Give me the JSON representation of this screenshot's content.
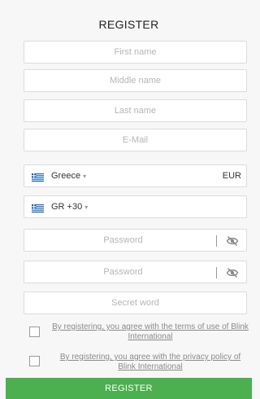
{
  "form": {
    "title": "REGISTER",
    "first_name_placeholder": "First name",
    "middle_name_placeholder": "Middle name",
    "last_name_placeholder": "Last name",
    "email_placeholder": "E-Mail",
    "country": {
      "flag_icon": "greece-flag-icon",
      "value": "Greece",
      "currency": "EUR"
    },
    "phone": {
      "flag_icon": "greece-flag-icon",
      "value": "GR +30"
    },
    "password_placeholder": "Password",
    "confirm_password_placeholder": "Password",
    "secret_word_placeholder": "Secret word",
    "terms_text": "By registering, you agree with the terms of use of Blink International",
    "privacy_text": "By registering, you agree with the privacy policy of Blink International",
    "register_button": "REGISTER"
  },
  "colors": {
    "accent": "#4caf50",
    "field_border": "#dcdcdc",
    "flag_blue": "#0d5eaf"
  },
  "icons": {
    "eye_toggle": "eye-slash-icon",
    "dropdown": "chevron-down-icon"
  }
}
